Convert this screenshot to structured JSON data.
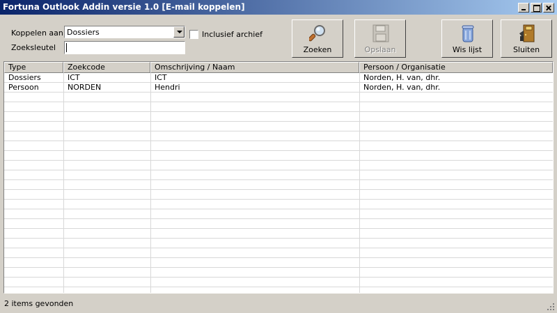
{
  "window": {
    "title": "Fortuna Outlook Addin versie 1.0 [E-mail koppelen]"
  },
  "form": {
    "koppelen_label": "Koppelen aan",
    "koppelen_value": "Dossiers",
    "zoeksleutel_label": "Zoeksleutel",
    "zoeksleutel_value": "",
    "archief_label": "Inclusief archief",
    "archief_checked": false
  },
  "toolbar": {
    "zoeken": "Zoeken",
    "opslaan": "Opslaan",
    "wis_lijst": "Wis lijst",
    "sluiten": "Sluiten"
  },
  "table": {
    "columns": [
      "Type",
      "Zoekcode",
      "Omschrijving / Naam",
      "Persoon / Organisatie"
    ],
    "rows": [
      [
        "Dossiers",
        "ICT",
        "ICT",
        "Norden, H. van, dhr."
      ],
      [
        "Persoon",
        "NORDEN",
        "Hendri",
        "Norden, H. van, dhr."
      ]
    ]
  },
  "status": {
    "text": "2 items gevonden"
  },
  "icons": {
    "zoeken": "magnifier-icon",
    "opslaan": "floppy-disk-icon",
    "wis_lijst": "trash-bin-icon",
    "sluiten": "exit-door-icon"
  }
}
